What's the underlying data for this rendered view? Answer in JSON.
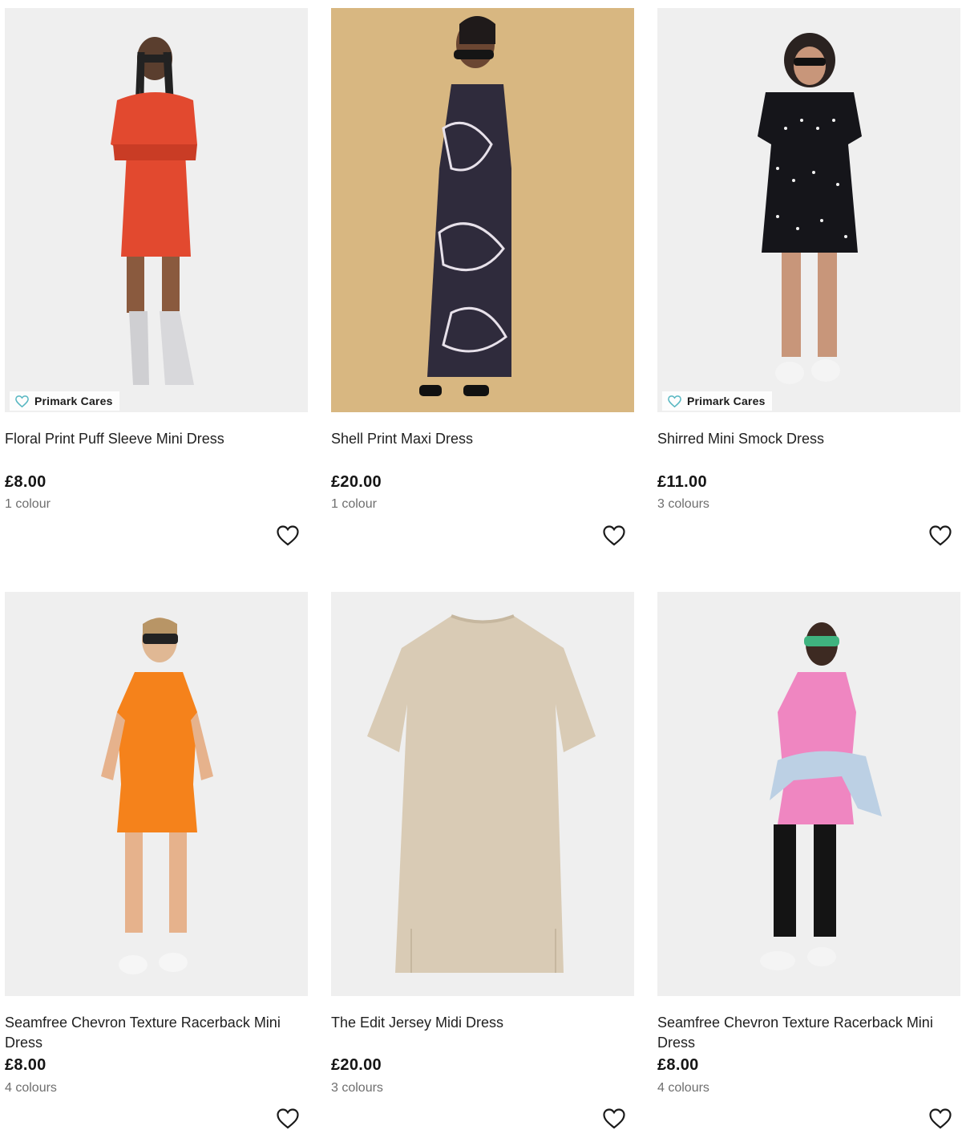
{
  "badge_label": "Primark Cares",
  "products": [
    {
      "title": "Floral Print Puff Sleeve Mini Dress",
      "price": "£8.00",
      "colours": "1 colour",
      "badge": true
    },
    {
      "title": "Shell Print Maxi Dress",
      "price": "£20.00",
      "colours": "1 colour",
      "badge": false
    },
    {
      "title": "Shirred Mini Smock Dress",
      "price": "£11.00",
      "colours": "3 colours",
      "badge": true
    },
    {
      "title": "Seamfree Chevron Texture Racerback Mini Dress",
      "price": "£8.00",
      "colours": "4 colours",
      "badge": false
    },
    {
      "title": "The Edit Jersey Midi Dress",
      "price": "£20.00",
      "colours": "3 colours",
      "badge": false
    },
    {
      "title": "Seamfree Chevron Texture Racerback Mini Dress",
      "price": "£8.00",
      "colours": "4 colours",
      "badge": false
    }
  ],
  "icons": {
    "wishlist": "heart-outline-icon",
    "badge": "heart-care-icon"
  },
  "colors": {
    "dress_red": "#e2492f",
    "dress_navy": "#2f2b3c",
    "dress_black": "#15151a",
    "dress_orange": "#f5821b",
    "dress_beige": "#d9cbb5",
    "dress_pink": "#ef86c1",
    "badge_accent": "#58b7c2",
    "studio_bg": "#efefef",
    "tan_bg": "#d8b781"
  }
}
